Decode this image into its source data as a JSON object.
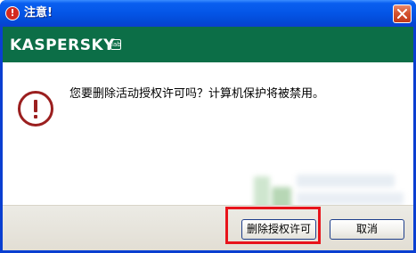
{
  "window": {
    "title": "注意!",
    "close_label": "×"
  },
  "brand": {
    "logo_text": "KASPERSKY",
    "logo_sup": "lab"
  },
  "dialog": {
    "message": "您要删除活动授权许可吗？计算机保护将被禁用。"
  },
  "buttons": {
    "confirm_label": "删除授权许可",
    "cancel_label": "取消"
  },
  "colors": {
    "titlebar": "#0a5ff0",
    "banner": "#0c6e47",
    "warning_red": "#9b1f1f",
    "highlight_border": "#e8141b"
  },
  "icons": {
    "title_icon": "warning-circle-icon",
    "dialog_icon": "exclamation-circle-icon",
    "close_icon": "close-icon"
  }
}
